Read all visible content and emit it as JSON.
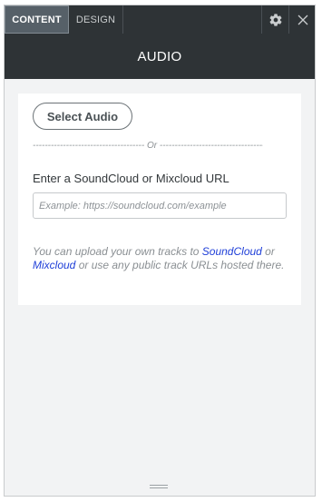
{
  "tabs": {
    "content_label": "CONTENT",
    "design_label": "DESIGN",
    "active": "CONTENT"
  },
  "icons": {
    "settings": "gear-icon",
    "close": "close-icon",
    "resize": "drag-handle-icon"
  },
  "header": {
    "title": "AUDIO"
  },
  "upload": {
    "button_label": "Select Audio",
    "divider_text": "------------------------------------- Or ------------------------------------"
  },
  "url_field": {
    "label": "Enter a SoundCloud or Mixcloud URL",
    "value": "",
    "placeholder": "Example: https://soundcloud.com/example"
  },
  "hint": {
    "text_1": "You can upload your own tracks to ",
    "link_1": "SoundCloud",
    "text_2": " or ",
    "link_2": "Mixcloud",
    "text_3": " or use any public track URLs hosted there."
  },
  "colors": {
    "topbar_bg": "#2e3336",
    "active_tab_bg": "#566068",
    "panel_bg": "#f2f3f4",
    "link": "#1f3fd8"
  }
}
